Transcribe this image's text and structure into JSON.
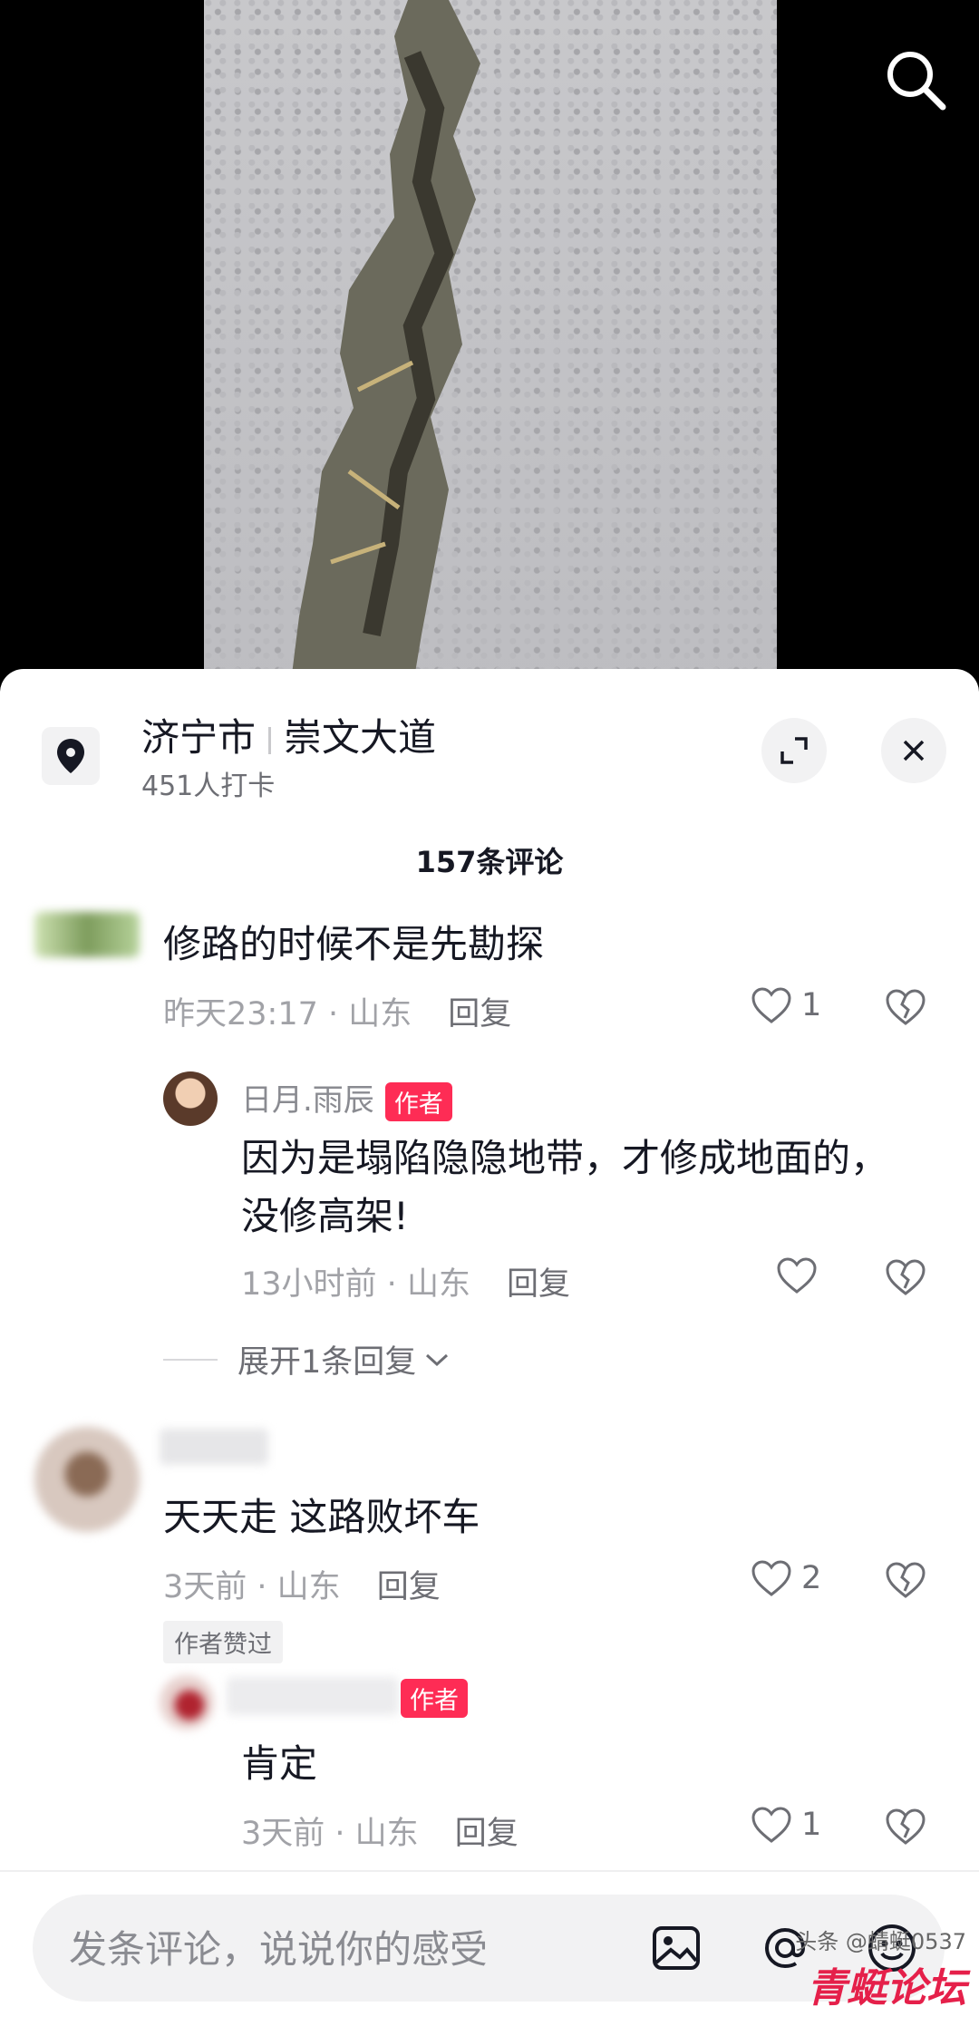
{
  "location": {
    "city": "济宁市",
    "road": "崇文大道",
    "checkins": "451人打卡"
  },
  "comments_count": "157条评论",
  "comments": [
    {
      "text": "修路的时候不是先勘探",
      "time": "昨天23:17",
      "region": "山东",
      "reply_label": "回复",
      "likes": "1",
      "replies": [
        {
          "name": "日月.雨辰",
          "tag": "作者",
          "text_line1": "因为是塌陷隐隐地带，才修成地面的，",
          "text_line2": "没修高架!",
          "time": "13小时前",
          "region": "山东",
          "reply_label": "回复",
          "likes": ""
        }
      ],
      "expand_label": "展开1条回复"
    },
    {
      "text": "天天走 这路败坏车",
      "time": "3天前",
      "region": "山东",
      "reply_label": "回复",
      "likes": "2",
      "badge": "作者赞过",
      "replies": [
        {
          "tag": "作者",
          "text": "肯定",
          "time": "3天前",
          "region": "山东",
          "reply_label": "回复",
          "likes": "1"
        }
      ]
    }
  ],
  "input": {
    "placeholder": "发条评论，说说你的感受"
  },
  "watermark": {
    "small": "头条 @蜻蜓0537",
    "big": "青蜓论坛"
  },
  "colors": {
    "accent": "#fe2c55",
    "text": "#161823",
    "muted": "#a1a2a7"
  }
}
